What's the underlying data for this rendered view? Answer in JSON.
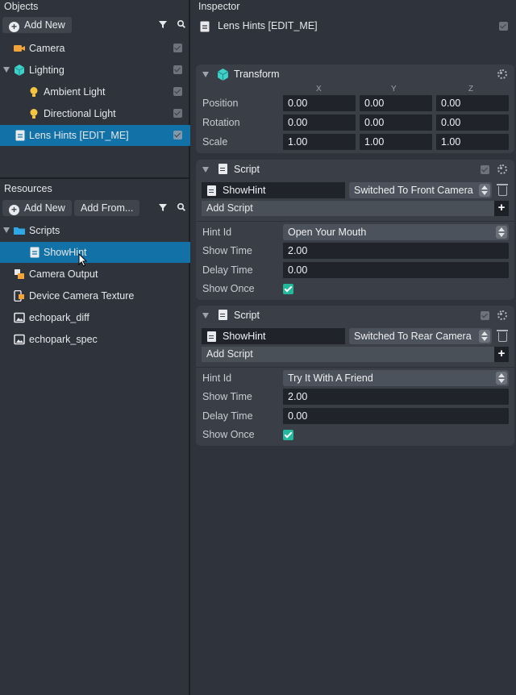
{
  "objects": {
    "title": "Objects",
    "add_new": "Add New",
    "items": [
      {
        "label": "Camera",
        "icon": "camera-icon"
      },
      {
        "label": "Lighting",
        "icon": "lighting-icon"
      },
      {
        "label": "Ambient Light",
        "icon": "bulb-icon"
      },
      {
        "label": "Directional Light",
        "icon": "bulb-icon"
      },
      {
        "label": "Lens Hints [EDIT_ME]",
        "icon": "script-doc-icon"
      }
    ]
  },
  "resources": {
    "title": "Resources",
    "add_new": "Add New",
    "add_from": "Add From...",
    "items": [
      {
        "label": "Scripts",
        "icon": "folder-icon"
      },
      {
        "label": "ShowHint",
        "icon": "script-doc-icon"
      },
      {
        "label": "Camera Output",
        "icon": "render-target-icon"
      },
      {
        "label": "Device Camera Texture",
        "icon": "device-camera-icon"
      },
      {
        "label": "echopark_diff",
        "icon": "image-icon"
      },
      {
        "label": "echopark_spec",
        "icon": "image-icon"
      }
    ]
  },
  "inspector": {
    "title": "Inspector",
    "object_name": "Lens Hints [EDIT_ME]",
    "transform": {
      "title": "Transform",
      "axes": [
        "X",
        "Y",
        "Z"
      ],
      "rows": [
        {
          "label": "Position",
          "values": [
            "0.00",
            "0.00",
            "0.00"
          ]
        },
        {
          "label": "Rotation",
          "values": [
            "0.00",
            "0.00",
            "0.00"
          ]
        },
        {
          "label": "Scale",
          "values": [
            "1.00",
            "1.00",
            "1.00"
          ]
        }
      ]
    },
    "scripts": [
      {
        "title": "Script",
        "script_name": "ShowHint",
        "event": "Switched To Front Camera",
        "add_script": "Add Script",
        "hint_id_label": "Hint Id",
        "hint_id": "Open Your Mouth",
        "show_time_label": "Show Time",
        "show_time": "2.00",
        "delay_time_label": "Delay Time",
        "delay_time": "0.00",
        "show_once_label": "Show Once",
        "show_once": true
      },
      {
        "title": "Script",
        "script_name": "ShowHint",
        "event": "Switched To Rear Camera",
        "add_script": "Add Script",
        "hint_id_label": "Hint Id",
        "hint_id": "Try It With A Friend",
        "show_time_label": "Show Time",
        "show_time": "2.00",
        "delay_time_label": "Delay Time",
        "delay_time": "0.00",
        "show_once_label": "Show Once",
        "show_once": true
      }
    ]
  },
  "colors": {
    "panel_bg": "#2f333b",
    "section_bg": "#3a3f47",
    "selection": "#1272a8",
    "field_bg": "#20232a",
    "checkbox_on": "#23b89b",
    "camera_orange": "#f2a33a",
    "lighting_teal": "#3fd0c9",
    "bulb_yellow": "#f5c542",
    "folder_blue": "#2ea8e6"
  }
}
